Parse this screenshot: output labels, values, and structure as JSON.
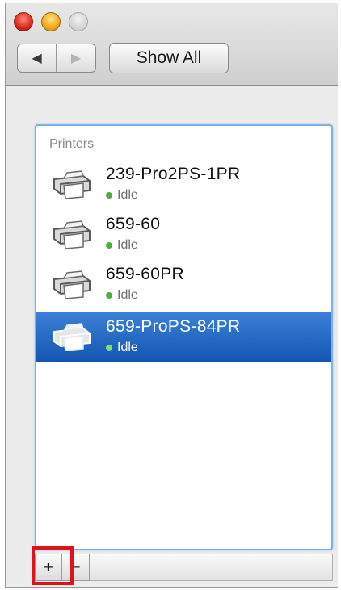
{
  "toolbar": {
    "show_all_label": "Show All",
    "back_icon": "◀",
    "forward_icon": "▶"
  },
  "printers": {
    "section_label": "Printers",
    "items": [
      {
        "name": "239-Pro2PS-1PR",
        "status": "Idle",
        "selected": false
      },
      {
        "name": "659-60",
        "status": "Idle",
        "selected": false
      },
      {
        "name": "659-60PR",
        "status": "Idle",
        "selected": false
      },
      {
        "name": "659-ProPS-84PR",
        "status": "Idle",
        "selected": true
      }
    ]
  },
  "bottom": {
    "add_label": "+",
    "remove_label": "−"
  },
  "colors": {
    "selection": "#1c5fbf",
    "status_idle": "#4caf3c",
    "highlight": "#e0121c"
  }
}
